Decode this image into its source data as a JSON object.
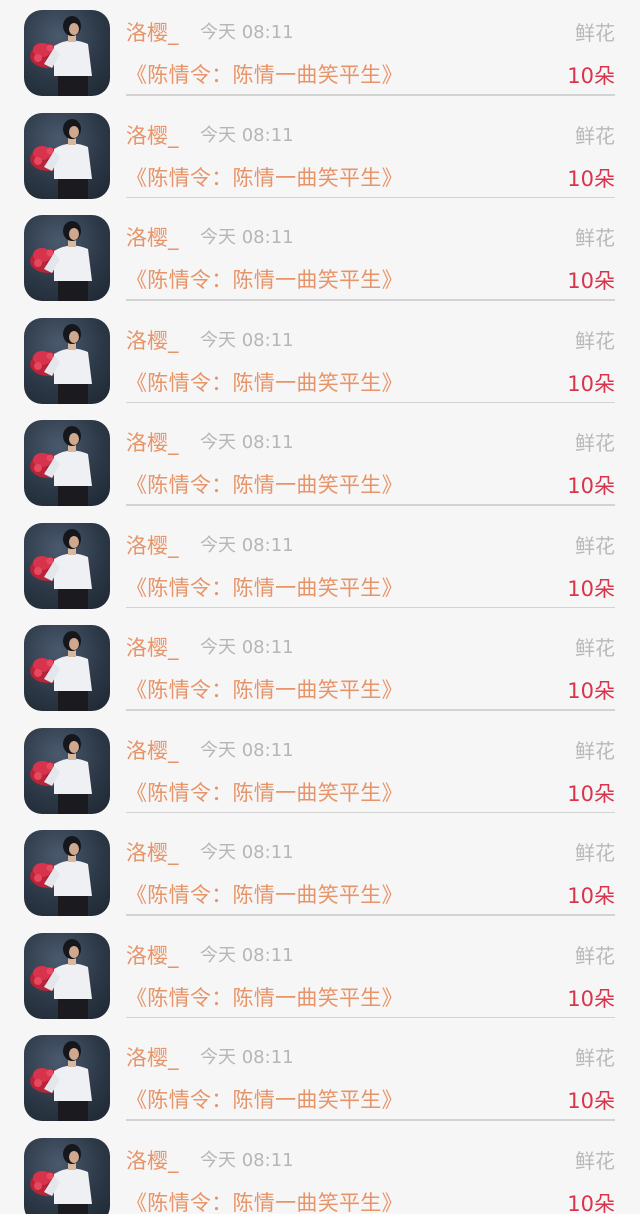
{
  "gift_records": [
    {
      "username": "洛樱_",
      "time": "今天 08:11",
      "gift_type": "鲜花",
      "drama": "《陈情令：陈情一曲笑平生》",
      "count": "10朵"
    },
    {
      "username": "洛樱_",
      "time": "今天 08:11",
      "gift_type": "鲜花",
      "drama": "《陈情令：陈情一曲笑平生》",
      "count": "10朵"
    },
    {
      "username": "洛樱_",
      "time": "今天 08:11",
      "gift_type": "鲜花",
      "drama": "《陈情令：陈情一曲笑平生》",
      "count": "10朵"
    },
    {
      "username": "洛樱_",
      "time": "今天 08:11",
      "gift_type": "鲜花",
      "drama": "《陈情令：陈情一曲笑平生》",
      "count": "10朵"
    },
    {
      "username": "洛樱_",
      "time": "今天 08:11",
      "gift_type": "鲜花",
      "drama": "《陈情令：陈情一曲笑平生》",
      "count": "10朵"
    },
    {
      "username": "洛樱_",
      "time": "今天 08:11",
      "gift_type": "鲜花",
      "drama": "《陈情令：陈情一曲笑平生》",
      "count": "10朵"
    },
    {
      "username": "洛樱_",
      "time": "今天 08:11",
      "gift_type": "鲜花",
      "drama": "《陈情令：陈情一曲笑平生》",
      "count": "10朵"
    },
    {
      "username": "洛樱_",
      "time": "今天 08:11",
      "gift_type": "鲜花",
      "drama": "《陈情令：陈情一曲笑平生》",
      "count": "10朵"
    },
    {
      "username": "洛樱_",
      "time": "今天 08:11",
      "gift_type": "鲜花",
      "drama": "《陈情令：陈情一曲笑平生》",
      "count": "10朵"
    },
    {
      "username": "洛樱_",
      "time": "今天 08:11",
      "gift_type": "鲜花",
      "drama": "《陈情令：陈情一曲笑平生》",
      "count": "10朵"
    },
    {
      "username": "洛樱_",
      "time": "今天 08:11",
      "gift_type": "鲜花",
      "drama": "《陈情令：陈情一曲笑平生》",
      "count": "10朵"
    },
    {
      "username": "洛樱_",
      "time": "今天 08:11",
      "gift_type": "鲜花",
      "drama": "《陈情令：陈情一曲笑平生》",
      "count": "10朵"
    }
  ],
  "colors": {
    "accent_orange": "#e79468",
    "count_red": "#d9344b",
    "muted_gray": "#b6b6b6",
    "background": "#f7f6f7"
  }
}
